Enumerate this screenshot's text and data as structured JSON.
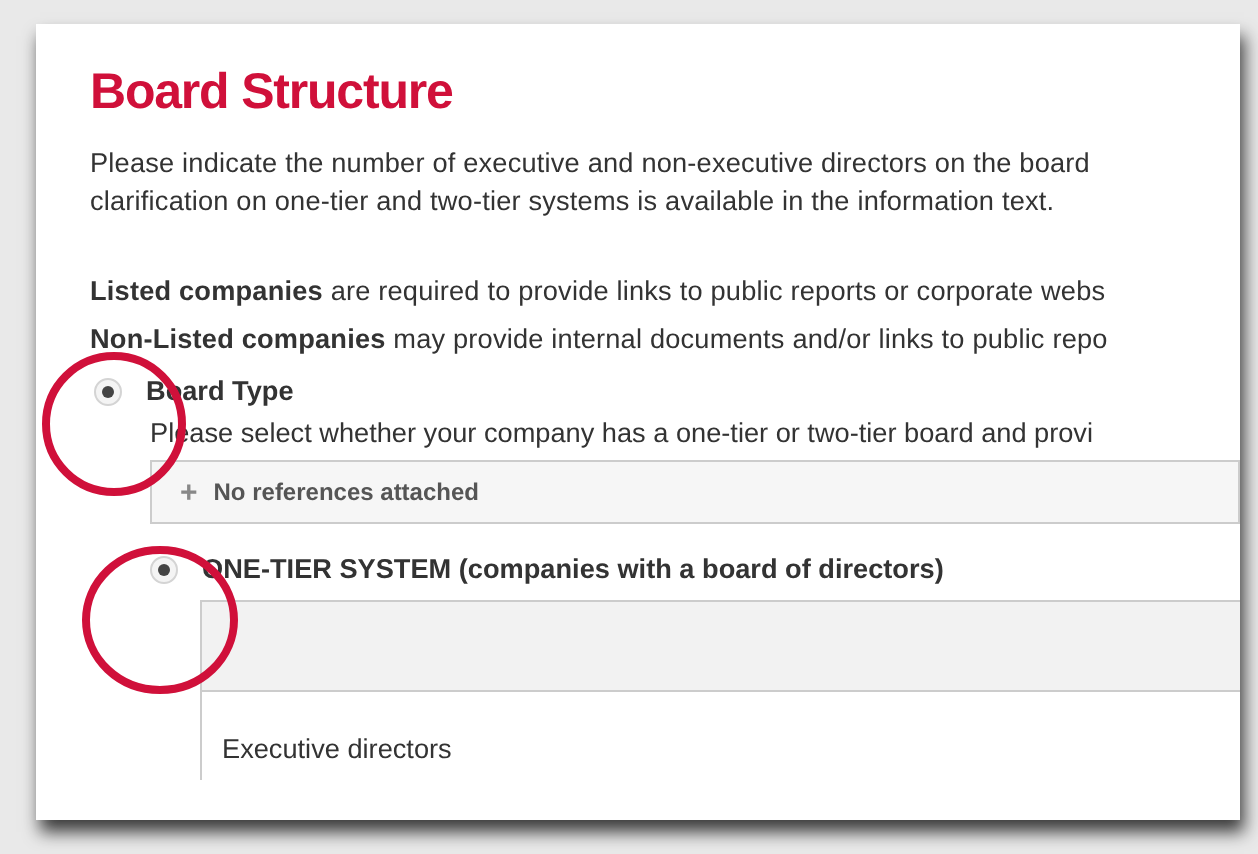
{
  "title": "Board Structure",
  "intro": "Please indicate the number of executive and non-executive directors on the board\nclarification on one-tier and two-tier systems is available in the information text.",
  "notes": [
    "**Listed companies** are required to provide links to public reports or corporate webs",
    "**Non-Listed companies** may provide internal documents and/or links to public repo"
  ],
  "board_type": {
    "label": "Board Type",
    "selected": true,
    "hint": "Please select whether your company has a one-tier or two-tier board and provi",
    "references": {
      "icon": "+",
      "text": "No references attached"
    }
  },
  "one_tier": {
    "label": "ONE-TIER SYSTEM (companies with a board of directors)",
    "selected": true,
    "field_label": "Executive directors"
  }
}
